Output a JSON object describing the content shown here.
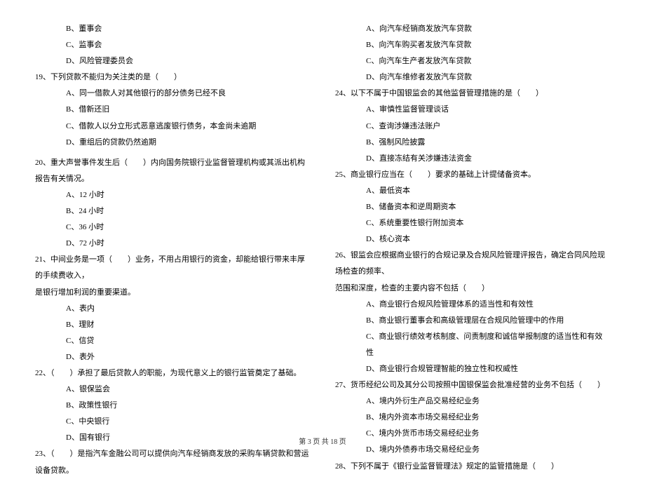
{
  "left": {
    "opts_pre": [
      "B、董事会",
      "C、监事会",
      "D、风险管理委员会"
    ],
    "q19": "19、下列贷款不能归为关注类的是（　　）",
    "q19opts": [
      "A、同一借款人对其他银行的部分债务已经不良",
      "B、借新还旧",
      "C、借款人以分立形式恶意逃废银行债务，本金尚未逾期",
      "D、重组后的贷款仍然逾期"
    ],
    "q20": "20、重大声誉事件发生后（　　）内向国务院银行业监督管理机构或其派出机构报告有关情况。",
    "q20opts": [
      "A、12 小时",
      "B、24 小时",
      "C、36 小时",
      "D、72 小时"
    ],
    "q21": "21、中间业务是一项（　　）业务，不用占用银行的资金，却能给银行带来丰厚的手续费收入，",
    "q21_cont": "是银行增加利润的重要渠道。",
    "q21opts": [
      "A、表内",
      "B、理财",
      "C、信贷",
      "D、表外"
    ],
    "q22": "22、（　　）承担了最后贷款人的职能，为现代意义上的银行监管奠定了基础。",
    "q22opts": [
      "A、银保监会",
      "B、政策性银行",
      "C、中央银行",
      "D、国有银行"
    ],
    "q23": "23、（　　）是指汽车金融公司可以提供向汽车经销商发放的采购车辆贷款和营运设备贷款。"
  },
  "right": {
    "q23opts": [
      "A、向汽车经销商发放汽车贷款",
      "B、向汽车购买者发放汽车贷款",
      "C、向汽车生产者发放汽车贷款",
      "D、向汽车维修者发放汽车贷款"
    ],
    "q24": "24、以下不属于中国银监会的其他监督管理措施的是（　　）",
    "q24opts": [
      "A、审慎性监督管理谈话",
      "C、查询涉嫌违法账户",
      "B、强制风险披露",
      "D、直接冻结有关涉嫌违法资金"
    ],
    "q25": "25、商业银行应当在（　　）要求的基础上计提储备资本。",
    "q25opts": [
      "A、最低资本",
      "B、储备资本和逆周期资本",
      "C、系统重要性银行附加资本",
      "D、核心资本"
    ],
    "q26": "26、银监会应根据商业银行的合规记录及合规风险管理评报告，确定合同风险现场检查的频率、",
    "q26_cont": "范围和深度，检查的主要内容不包括（　　）",
    "q26opts": [
      "A、商业银行合规风险管理体系的适当性和有效性",
      "B、商业银行董事会和高级管理层在合规风险管理中的作用",
      "C、商业银行绩效考核制度、问责制度和诚信举报制度的适当性和有效性",
      "D、商业银行合规管理智能的独立性和权威性"
    ],
    "q27": "27、货币经纪公司及其分公司按照中国银保监会批准经营的业务不包括（　　）",
    "q27opts": [
      "A、境内外衍生产品交易经纪业务",
      "B、境内外资本市场交易经纪业务",
      "C、境内外货币市场交易经纪业务",
      "D、境内外债券市场交易经纪业务"
    ],
    "q28": "28、下列不属于《银行业监督管理法》规定的监管措施是（　　）"
  },
  "footer": "第 3 页 共 18 页"
}
